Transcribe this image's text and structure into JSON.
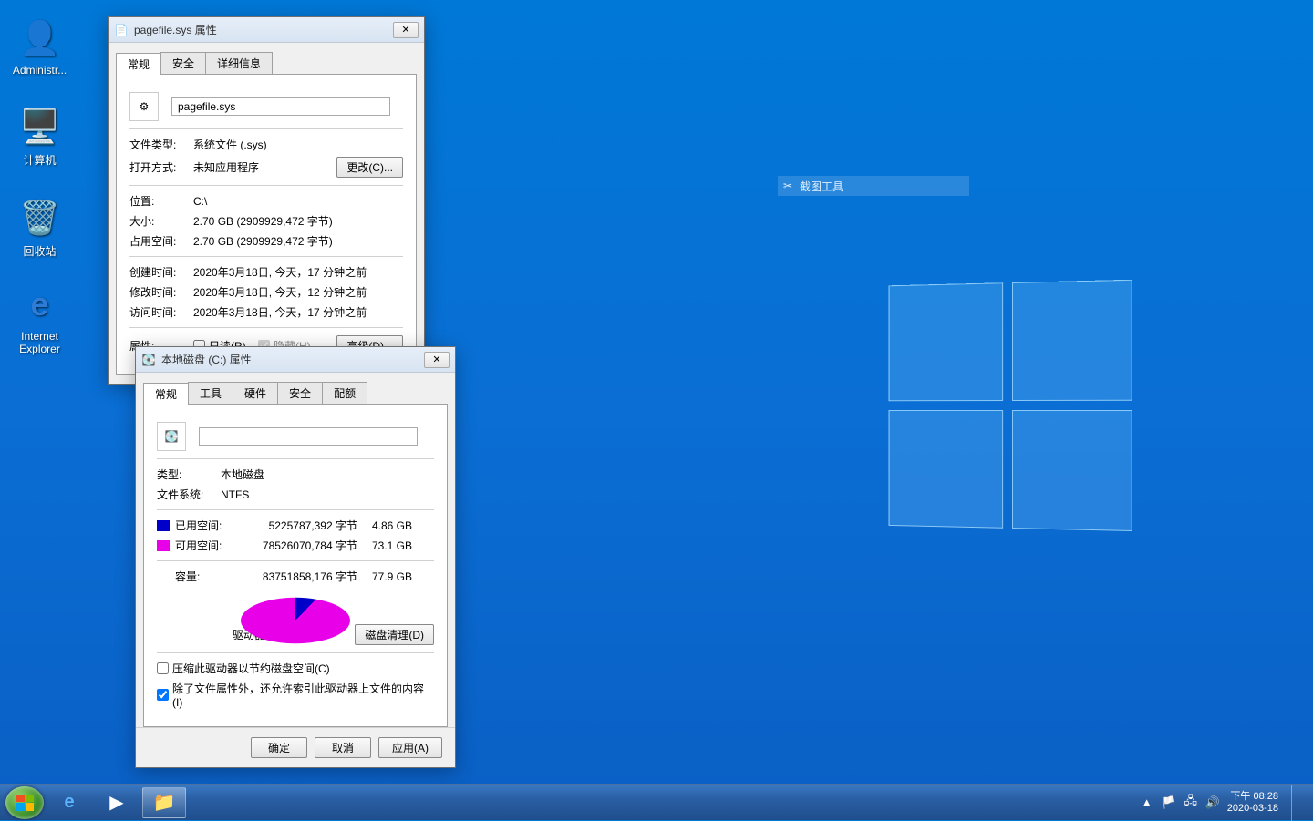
{
  "desktop": {
    "icons": {
      "admin": "Administr...",
      "computer": "计算机",
      "recycle": "回收站",
      "ie_line1": "Internet",
      "ie_line2": "Explorer"
    },
    "snip_tool": "截图工具"
  },
  "dlg1": {
    "title": "pagefile.sys 属性",
    "tabs": [
      "常规",
      "安全",
      "详细信息"
    ],
    "filename": "pagefile.sys",
    "rows": {
      "type_label": "文件类型:",
      "type_value": "系统文件 (.sys)",
      "open_label": "打开方式:",
      "open_value": "未知应用程序",
      "change_btn": "更改(C)...",
      "loc_label": "位置:",
      "loc_value": "C:\\",
      "size_label": "大小:",
      "size_value": "2.70 GB (2909929,472 字节)",
      "disk_label": "占用空间:",
      "disk_value": "2.70 GB (2909929,472 字节)",
      "created_label": "创建时间:",
      "created_value": "2020年3月18日, 今天，17 分钟之前",
      "modified_label": "修改时间:",
      "modified_value": "2020年3月18日, 今天，12 分钟之前",
      "accessed_label": "访问时间:",
      "accessed_value": "2020年3月18日, 今天，17 分钟之前",
      "attr_label": "属性:",
      "readonly": "只读(R)",
      "hidden": "隐藏(H)",
      "advanced_btn": "高级(D)..."
    }
  },
  "dlg2": {
    "title": "本地磁盘 (C:) 属性",
    "tabs": [
      "常规",
      "工具",
      "硬件",
      "安全",
      "配额"
    ],
    "volume_name": "",
    "type_label": "类型:",
    "type_value": "本地磁盘",
    "fs_label": "文件系统:",
    "fs_value": "NTFS",
    "used_label": "已用空间:",
    "used_bytes": "5225787,392 字节",
    "used_human": "4.86 GB",
    "free_label": "可用空间:",
    "free_bytes": "78526070,784 字节",
    "free_human": "73.1 GB",
    "cap_label": "容量:",
    "cap_bytes": "83751858,176 字节",
    "cap_human": "77.9 GB",
    "drive_label": "驱动器 C:",
    "cleanup_btn": "磁盘清理(D)",
    "compress": "压缩此驱动器以节约磁盘空间(C)",
    "index": "除了文件属性外，还允许索引此驱动器上文件的内容(I)",
    "ok": "确定",
    "cancel": "取消",
    "apply": "应用(A)"
  },
  "taskbar": {
    "time_line1": "下午 08:28",
    "time_line2": "2020-03-18"
  }
}
